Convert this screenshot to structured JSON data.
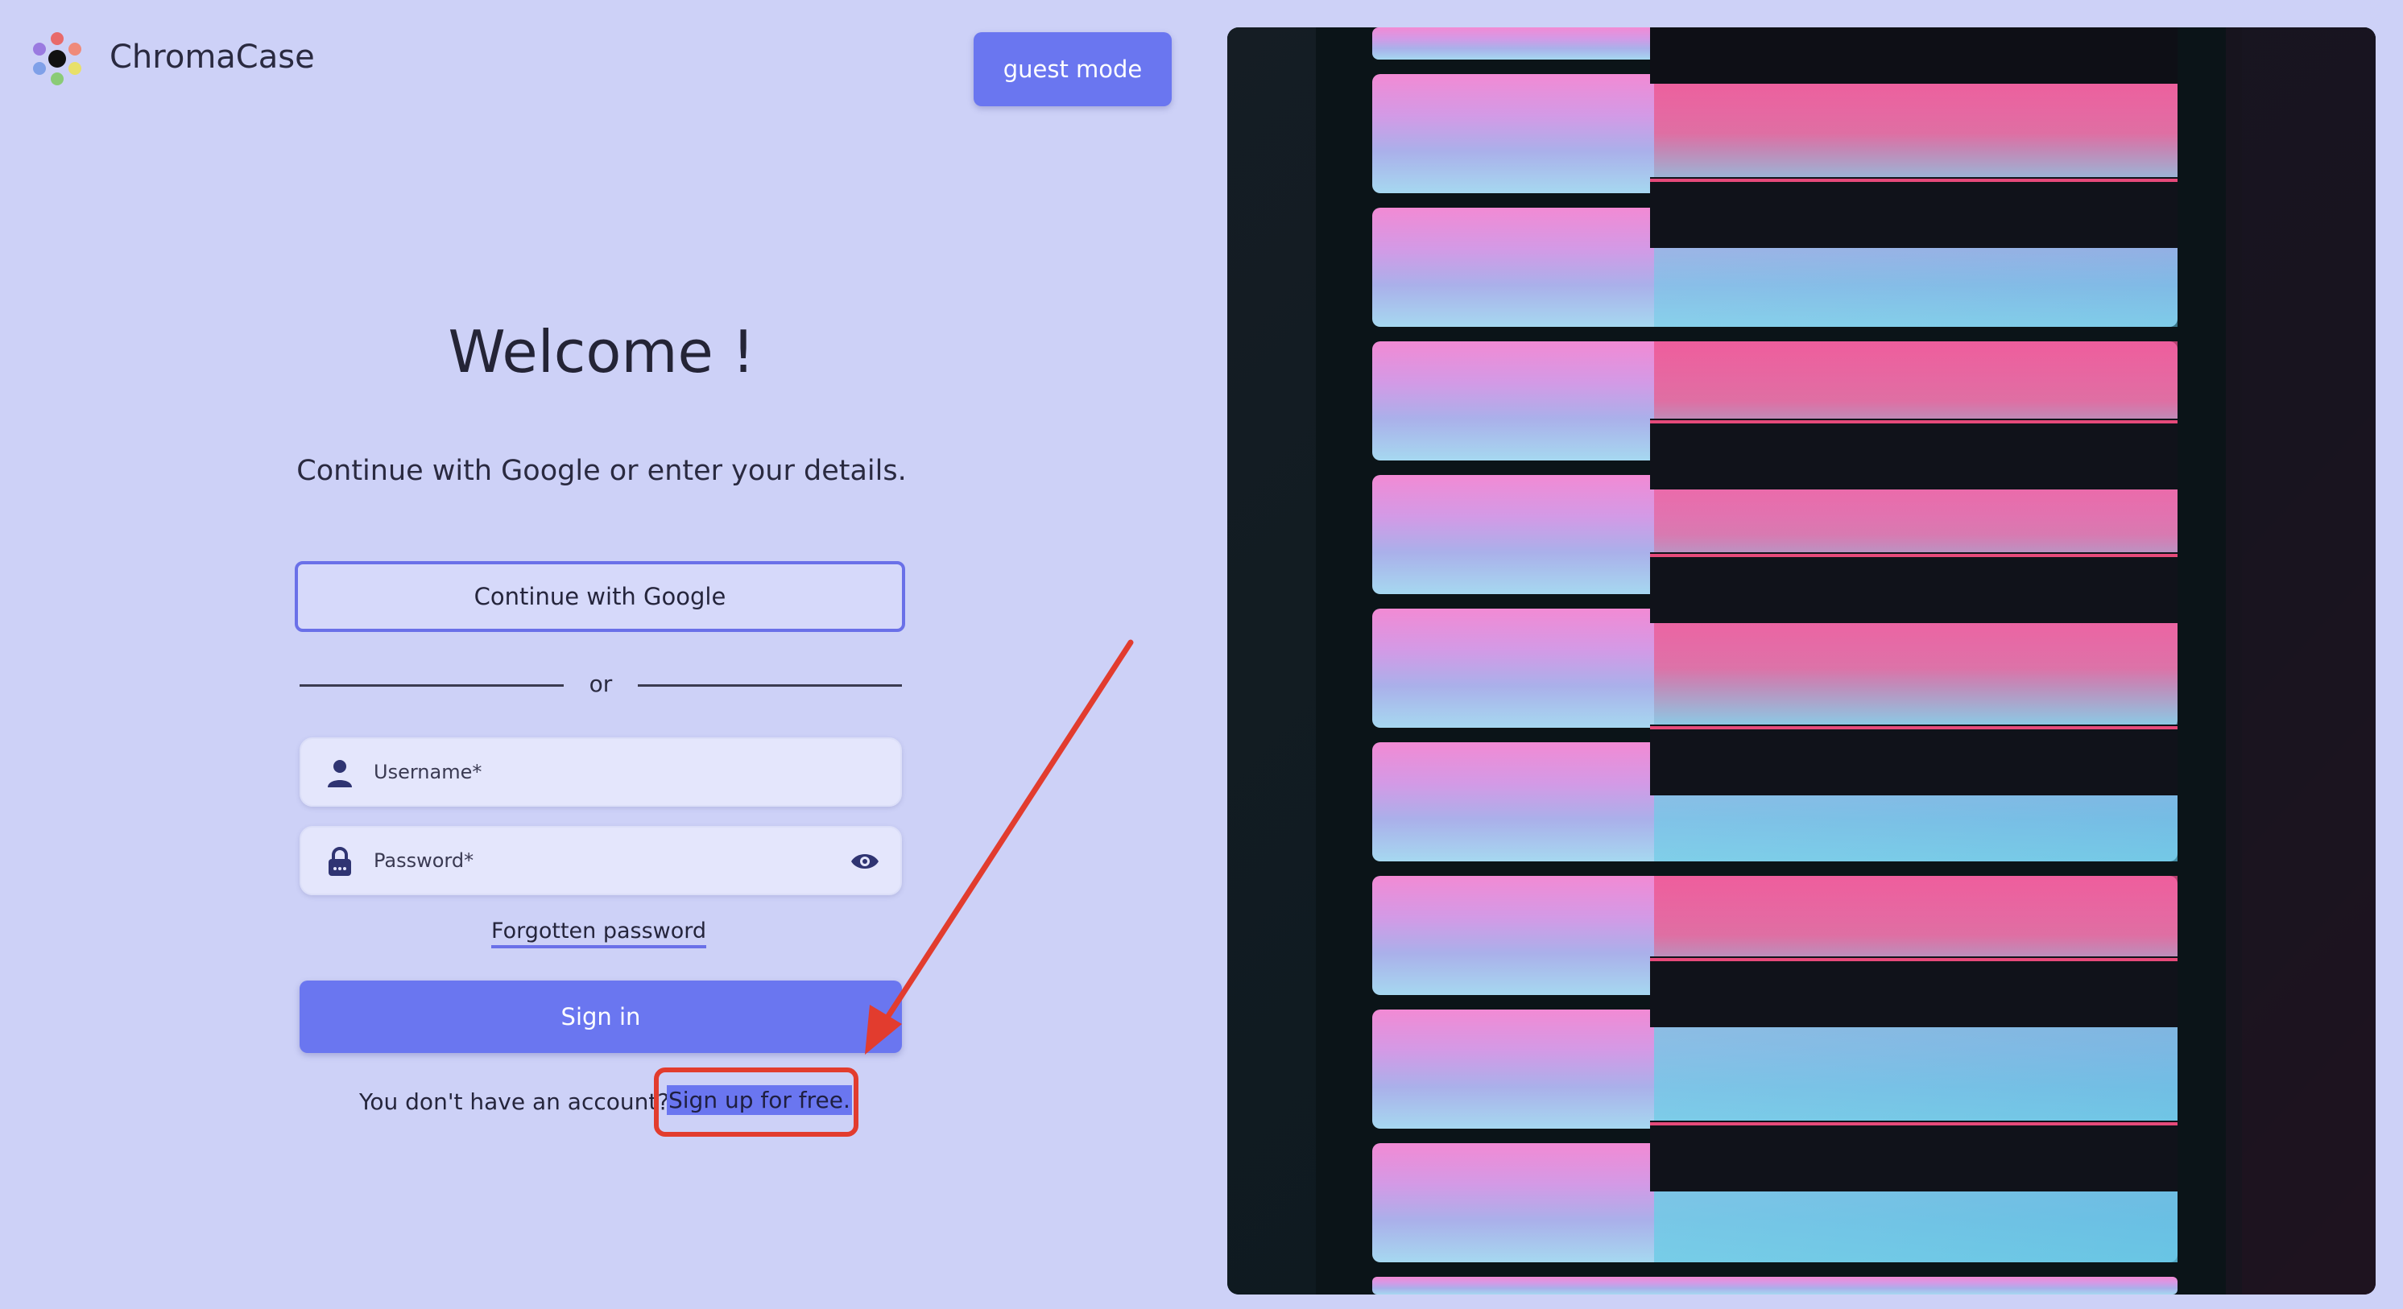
{
  "brand": {
    "name": "ChromaCase",
    "logo_icon": "flower-logo-icon"
  },
  "header": {
    "guest_label": "guest mode"
  },
  "main": {
    "title": "Welcome !",
    "subtitle": "Continue with Google or enter your details.",
    "google_label": "Continue with Google",
    "separator": "or",
    "username": {
      "placeholder": "Username*",
      "value": "",
      "icon": "user-icon"
    },
    "password": {
      "placeholder": "Password*",
      "value": "",
      "icon": "lock-icon",
      "toggle_icon": "eye-icon"
    },
    "forgot_label": "Forgotten password",
    "signin_label": "Sign in",
    "no_account_text": "You don't have an account?",
    "signup_label": "Sign up for free."
  },
  "annotation": {
    "color": "#e23c2e",
    "target": "Sign up for free."
  },
  "colors": {
    "background": "#cdd1f7",
    "accent": "#6a76f0",
    "outline": "#6a70e8",
    "annotation": "#e23c2e"
  },
  "hero_image": {
    "subject": "piano-keys-photo"
  }
}
